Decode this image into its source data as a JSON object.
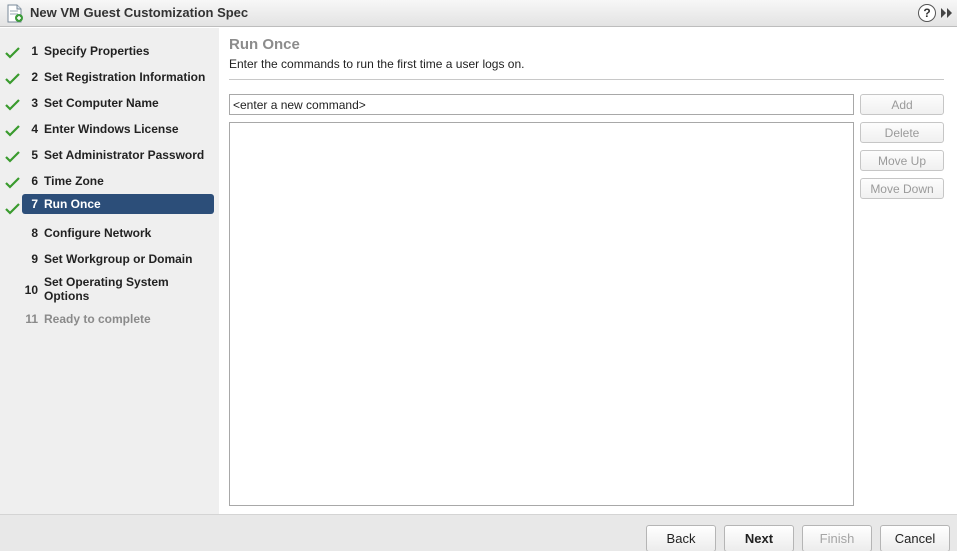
{
  "window": {
    "title": "New VM Guest Customization Spec",
    "icons": {
      "app": "document-wizard-icon",
      "help": "help-icon",
      "expand": "double-chevron-right-icon"
    },
    "help_glyph": "?"
  },
  "steps": [
    {
      "number": "1",
      "label": "Specify Properties",
      "state": "done"
    },
    {
      "number": "2",
      "label": "Set Registration Information",
      "state": "done"
    },
    {
      "number": "3",
      "label": "Set Computer Name",
      "state": "done"
    },
    {
      "number": "4",
      "label": "Enter Windows License",
      "state": "done"
    },
    {
      "number": "5",
      "label": "Set Administrator Password",
      "state": "done"
    },
    {
      "number": "6",
      "label": "Time Zone",
      "state": "done"
    },
    {
      "number": "7",
      "label": "Run Once",
      "state": "active"
    },
    {
      "number": "8",
      "label": "Configure Network",
      "state": "pending"
    },
    {
      "number": "9",
      "label": "Set Workgroup or Domain",
      "state": "pending"
    },
    {
      "number": "10",
      "label": "Set Operating System Options",
      "state": "pending"
    },
    {
      "number": "11",
      "label": "Ready to complete",
      "state": "disabled"
    }
  ],
  "page": {
    "title": "Run Once",
    "description": "Enter the commands to run the first time a user logs on.",
    "command_input": {
      "value": "<enter a new command>"
    },
    "buttons": {
      "add": "Add",
      "delete": "Delete",
      "move_up": "Move Up",
      "move_down": "Move Down"
    }
  },
  "footer": {
    "back": "Back",
    "next": "Next",
    "finish": "Finish",
    "cancel": "Cancel"
  },
  "colors": {
    "active_step": "#2c4e79",
    "check": "#3a9b2e",
    "sidebar_bg": "#efefef"
  }
}
